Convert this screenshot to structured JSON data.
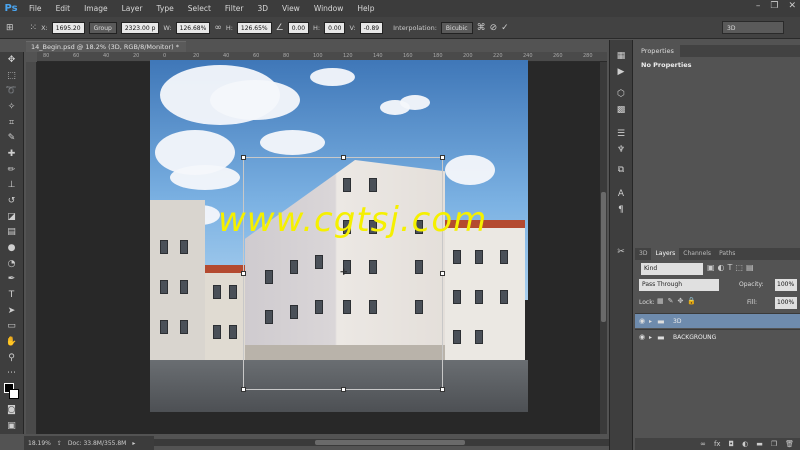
{
  "app": {
    "logo": "Ps"
  },
  "menu": [
    "File",
    "Edit",
    "Image",
    "Layer",
    "Type",
    "Select",
    "Filter",
    "3D",
    "View",
    "Window",
    "Help"
  ],
  "window_controls": {
    "minimize": "–",
    "restore": "❐",
    "close": "✕"
  },
  "options": {
    "x_label": "X:",
    "x_value": "1695.20",
    "group_value": "Group",
    "y_value": "2323.00 p",
    "w_label": "W:",
    "w_value": "126.68%",
    "h_label": "H:",
    "h_value": "126.65%",
    "angle_value": "0.00",
    "hskew_label": "H:",
    "hskew_value": "0.00",
    "vskew_label": "V:",
    "vskew_value": "-0.89",
    "interp_label": "Interpolation:",
    "interp_value": "Bicubic",
    "workspace": "3D"
  },
  "document": {
    "tab_title": "14_Begin.psd @ 18.2% (3D, RGB/8/Monitor) *"
  },
  "ruler_ticks": [
    "80",
    "60",
    "40",
    "20",
    "0",
    "20",
    "40",
    "60",
    "80",
    "100",
    "120",
    "140",
    "160",
    "180",
    "200",
    "220",
    "240",
    "260",
    "280"
  ],
  "watermark": "www.cgtsj.com",
  "status": {
    "zoom": "18.19%",
    "doc": "Doc: 33.8M/355.8M"
  },
  "properties": {
    "tab": "Properties",
    "title": "No Properties"
  },
  "layers": {
    "tabs": [
      "3D",
      "Layers",
      "Channels",
      "Paths"
    ],
    "kind": "Kind",
    "blend": "Pass Through",
    "opacity_label": "Opacity:",
    "opacity_value": "100%",
    "lock_label": "Lock:",
    "fill_label": "Fill:",
    "fill_value": "100%",
    "rows": [
      {
        "name": "3D",
        "selected": true
      },
      {
        "name": "BACKGROUNG",
        "selected": false
      }
    ]
  }
}
